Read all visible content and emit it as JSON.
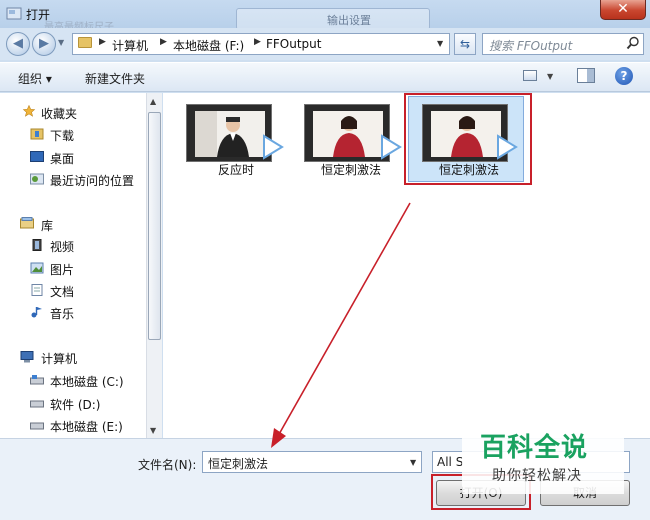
{
  "window": {
    "title": "打开",
    "ghost_label": "输出设置",
    "ghost_text": "最高最频标尺子"
  },
  "address": {
    "crumbs": [
      "计算机",
      "本地磁盘 (F:)",
      "FFOutput"
    ],
    "search_placeholder": "搜索 FFOutput"
  },
  "toolbar": {
    "organize": "组织 ▾",
    "new_folder": "新建文件夹"
  },
  "nav": {
    "favorites_header": "收藏夹",
    "favorites": [
      "下载",
      "桌面",
      "最近访问的位置"
    ],
    "libraries_header": "库",
    "libraries": [
      "视频",
      "图片",
      "文档",
      "音乐"
    ],
    "computer_header": "计算机",
    "drives": [
      "本地磁盘 (C:)",
      "软件 (D:)",
      "本地磁盘 (E:)"
    ]
  },
  "files": [
    {
      "name": "反应时",
      "person": "man",
      "selected": false
    },
    {
      "name": "恒定刺激法",
      "person": "woman",
      "selected": false
    },
    {
      "name": "恒定刺激法",
      "person": "woman",
      "selected": true
    }
  ],
  "bottom": {
    "filename_label": "文件名(N):",
    "filename_value": "恒定刺激法",
    "filter_value": "All S",
    "open_button": "打开(O)",
    "cancel_button": "取消"
  },
  "watermark": {
    "title": "百科全说",
    "subtitle": "助你轻松解决"
  },
  "colors": {
    "highlight": "#c8202a",
    "selection": "#cce4f9",
    "watermark": "#1aa260"
  }
}
